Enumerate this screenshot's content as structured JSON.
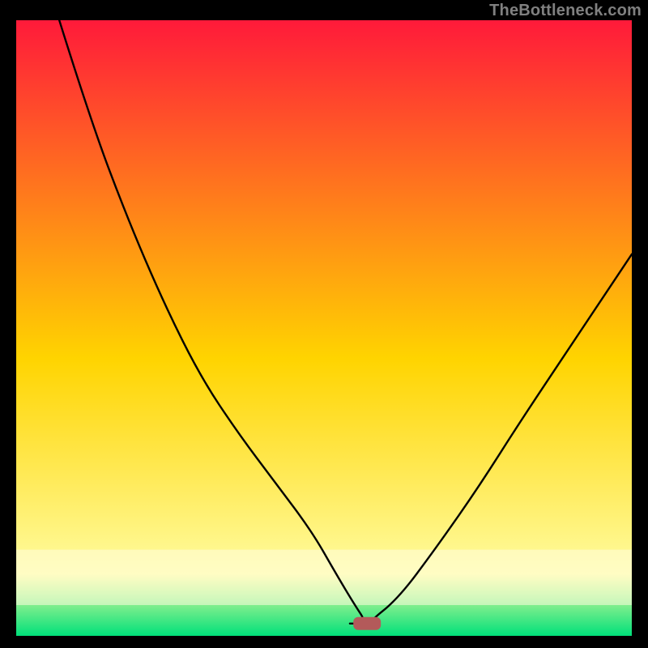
{
  "watermark": "TheBottleneck.com",
  "chart_data": {
    "type": "line",
    "title": "",
    "xlabel": "",
    "ylabel": "",
    "xlim": [
      0,
      100
    ],
    "ylim": [
      0,
      100
    ],
    "background_gradient": {
      "top_color": "#ff1a3a",
      "mid_color": "#ffd400",
      "bottom_color": "#00e07a",
      "band_near_bottom_color": "#fffca0"
    },
    "marker": {
      "x": 57,
      "y": 2,
      "color": "#b35a5a",
      "shape": "rounded-rect"
    },
    "series": [
      {
        "name": "curve-left",
        "type": "line",
        "x": [
          7,
          12,
          18,
          24,
          30,
          36,
          42,
          48,
          52,
          55,
          57
        ],
        "y": [
          100,
          84,
          68,
          54,
          42,
          33,
          25,
          17,
          10,
          5,
          2
        ]
      },
      {
        "name": "valley-floor",
        "type": "line",
        "x": [
          53,
          59
        ],
        "y": [
          2,
          2
        ]
      },
      {
        "name": "curve-right",
        "type": "line",
        "x": [
          57,
          62,
          68,
          75,
          82,
          90,
          100
        ],
        "y": [
          2,
          6,
          14,
          24,
          35,
          47,
          62
        ]
      }
    ]
  },
  "colors": {
    "frame": "#000000",
    "line": "#000000",
    "watermark": "#808080"
  }
}
